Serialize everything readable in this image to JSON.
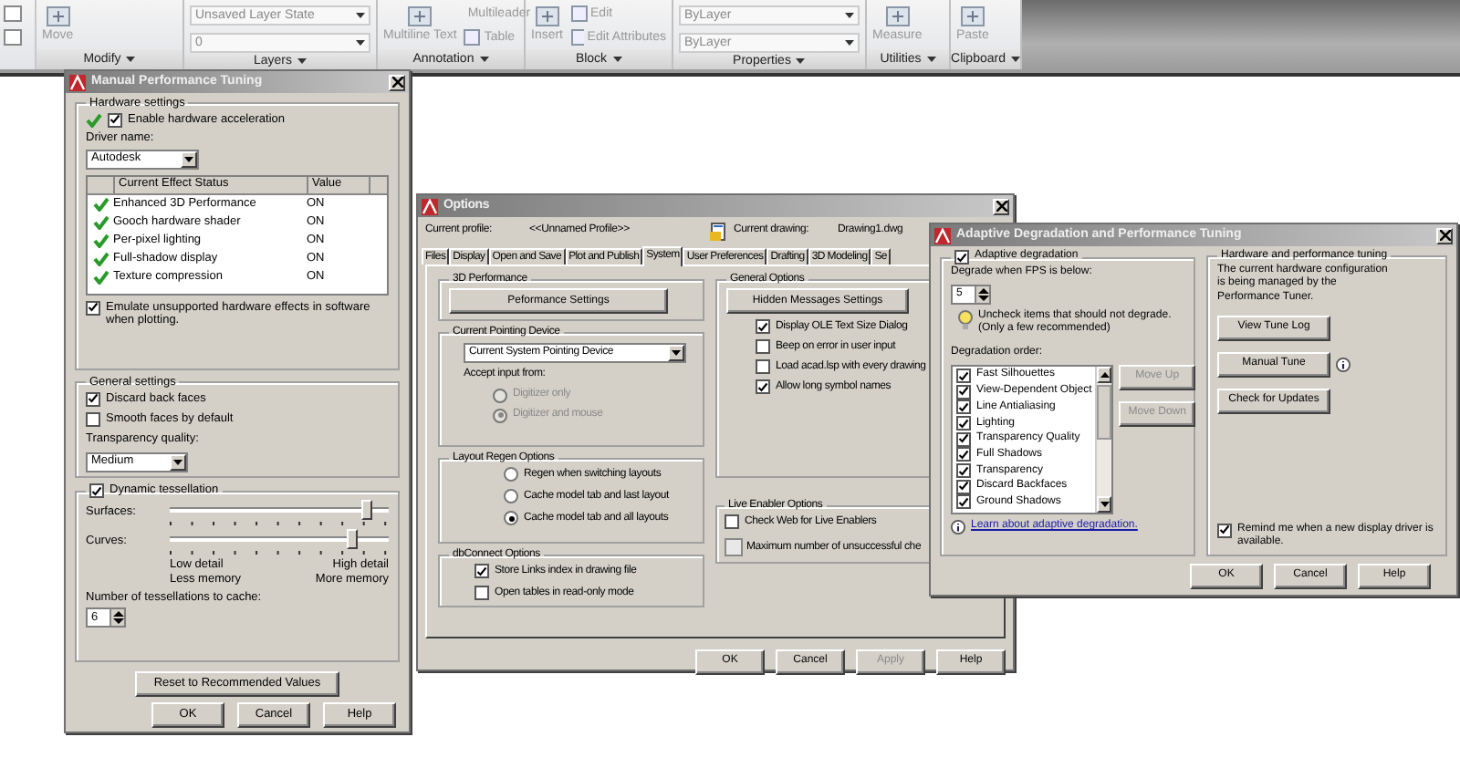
{
  "ribbon": {
    "panels": [
      {
        "label": "Modify",
        "tools": [
          {
            "kind": "large",
            "label": "Move"
          }
        ]
      },
      {
        "label": "Layers",
        "tools": [
          {
            "kind": "dropdown",
            "label": "Unsaved Layer State"
          },
          {
            "kind": "dropdown",
            "label": "0"
          }
        ]
      },
      {
        "label": "Annotation",
        "tools": [
          {
            "kind": "large",
            "label": "Multiline Text"
          },
          {
            "kind": "small",
            "label": "Multileader"
          },
          {
            "kind": "small",
            "label": "Table"
          }
        ]
      },
      {
        "label": "Block",
        "tools": [
          {
            "kind": "large",
            "label": "Insert"
          },
          {
            "kind": "small",
            "label": "Edit"
          },
          {
            "kind": "small",
            "label": "Edit Attributes"
          }
        ]
      },
      {
        "label": "Properties",
        "tools": [
          {
            "kind": "dropdown",
            "label": "ByLayer"
          },
          {
            "kind": "dropdown",
            "label": "ByLayer"
          }
        ]
      },
      {
        "label": "Utilities",
        "tools": [
          {
            "kind": "large",
            "label": "Measure"
          }
        ]
      },
      {
        "label": "Clipboard",
        "tools": [
          {
            "kind": "large",
            "label": "Paste"
          }
        ]
      }
    ]
  },
  "tuning": {
    "title": "Manual Performance Tuning",
    "hardware": {
      "legend": "Hardware settings",
      "acceleration": {
        "label": "Enable hardware acceleration",
        "checked": true
      },
      "driver_label": "Driver name:",
      "driver": "Autodesk",
      "columns": [
        "Current Effect Status",
        "Value"
      ],
      "effects": [
        {
          "name": "Enhanced 3D Performance",
          "value": "ON"
        },
        {
          "name": "Gooch hardware shader",
          "value": "ON"
        },
        {
          "name": "Per-pixel lighting",
          "value": "ON"
        },
        {
          "name": "Full-shadow display",
          "value": "ON"
        },
        {
          "name": "Texture compression",
          "value": "ON"
        }
      ],
      "emulate": {
        "label": "Emulate unsupported hardware effects in software when plotting.",
        "checked": true
      }
    },
    "general": {
      "legend": "General settings",
      "discard": {
        "label": "Discard back faces",
        "checked": true
      },
      "smooth": {
        "label": "Smooth faces by default",
        "checked": false
      },
      "transparency_label": "Transparency quality:",
      "transparency": "Medium"
    },
    "tessellation": {
      "label": "Dynamic tessellation",
      "checked": true,
      "sliders": [
        {
          "label": "Surfaces:",
          "level": 0.92
        },
        {
          "label": "Curves:",
          "level": 0.85
        }
      ],
      "low": [
        "Low detail",
        "Less memory"
      ],
      "high": [
        "High detail",
        "More memory"
      ],
      "cache_label": "Number of tessellations to cache:",
      "cache": "6"
    },
    "reset": "Reset to Recommended Values",
    "buttons": [
      "OK",
      "Cancel",
      "Help"
    ]
  },
  "options": {
    "title": "Options",
    "profile_label": "Current profile:",
    "profile": "<<Unnamed Profile>>",
    "drawing_label": "Current drawing:",
    "drawing": "Drawing1.dwg",
    "tabs": [
      {
        "label": "Files",
        "selected": false
      },
      {
        "label": "Display",
        "selected": false
      },
      {
        "label": "Open and Save",
        "selected": false
      },
      {
        "label": "Plot and Publish",
        "selected": false
      },
      {
        "label": "System",
        "selected": true
      },
      {
        "label": "User Preferences",
        "selected": false
      },
      {
        "label": "Drafting",
        "selected": false
      },
      {
        "label": "3D Modeling",
        "selected": false
      },
      {
        "label": "Se",
        "selected": false
      }
    ],
    "performance": {
      "legend": "3D Performance",
      "button": "Peformance Settings"
    },
    "pointing": {
      "legend": "Current Pointing Device",
      "device": "Current System Pointing Device",
      "accept_label": "Accept input from:",
      "options": [
        {
          "label": "Digitizer only",
          "selected": false,
          "disabled": true
        },
        {
          "label": "Digitizer and mouse",
          "selected": true,
          "disabled": true
        }
      ]
    },
    "layout_regen": {
      "legend": "Layout Regen Options",
      "options": [
        {
          "label": "Regen when switching layouts",
          "selected": false
        },
        {
          "label": "Cache model tab and last layout",
          "selected": false
        },
        {
          "label": "Cache model tab and all layouts",
          "selected": true
        }
      ]
    },
    "dbconnect": {
      "legend": "dbConnect Options",
      "options": [
        {
          "label": "Store Links index in drawing file",
          "checked": true
        },
        {
          "label": "Open tables in read-only mode",
          "checked": false
        }
      ]
    },
    "general": {
      "legend": "General Options",
      "button": "Hidden Messages Settings",
      "options": [
        {
          "label": "Display OLE Text Size Dialog",
          "checked": true
        },
        {
          "label": "Beep on error in user input",
          "checked": false
        },
        {
          "label": "Load acad.lsp with every drawing",
          "checked": false
        },
        {
          "label": "Allow long symbol names",
          "checked": true
        }
      ]
    },
    "live": {
      "legend": "Live Enabler Options",
      "check": {
        "label": "Check Web for Live Enablers",
        "checked": false
      },
      "max_label": "Maximum number of unsuccessful che"
    },
    "buttons": [
      {
        "label": "OK",
        "disabled": false
      },
      {
        "label": "Cancel",
        "disabled": false
      },
      {
        "label": "Apply",
        "disabled": true
      },
      {
        "label": "Help",
        "disabled": false
      }
    ]
  },
  "adaptive": {
    "title": "Adaptive Degradation and Performance Tuning",
    "enabled": {
      "label": "Adaptive degradation",
      "checked": true
    },
    "fps_label": "Degrade when FPS is below:",
    "fps": "5",
    "hint": [
      "Uncheck items that should not degrade.",
      "(Only a few recommended)"
    ],
    "order_label": "Degradation order:",
    "order": [
      {
        "label": "Fast Silhouettes",
        "checked": true
      },
      {
        "label": "View-Dependent Object",
        "checked": true
      },
      {
        "label": "Line Antialiasing",
        "checked": true
      },
      {
        "label": "Lighting",
        "checked": true
      },
      {
        "label": "Transparency Quality",
        "checked": true
      },
      {
        "label": "Full Shadows",
        "checked": true
      },
      {
        "label": "Transparency",
        "checked": true
      },
      {
        "label": "Discard Backfaces",
        "checked": true
      },
      {
        "label": "Ground Shadows",
        "checked": true
      }
    ],
    "move": [
      {
        "label": "Move Up",
        "disabled": true
      },
      {
        "label": "Move Down",
        "disabled": true
      }
    ],
    "learn": "Learn about adaptive degradation.",
    "hw": {
      "legend": "Hardware and performance tuning",
      "text": "The current hardware configuration is being managed by the Performance Tuner.",
      "buttons": [
        "View Tune Log",
        "Manual Tune",
        "Check for Updates"
      ]
    },
    "remind": {
      "label": "Remind me when a new display driver is available.",
      "checked": true
    },
    "buttons": [
      "OK",
      "Cancel",
      "Help"
    ]
  }
}
